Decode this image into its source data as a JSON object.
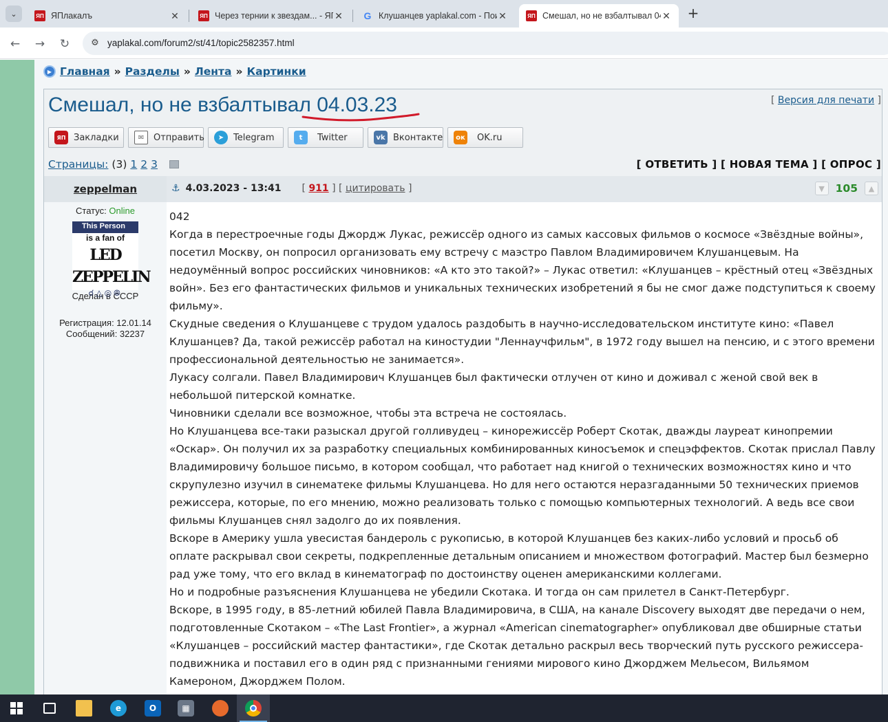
{
  "browser": {
    "tabs": [
      {
        "title": "ЯПлакалъ",
        "favicon": "yap-icon",
        "active": false
      },
      {
        "title": "Через тернии к звездам... - ЯП",
        "favicon": "yap-icon",
        "active": false
      },
      {
        "title": "Клушанцев yaplakal.com - Пои",
        "favicon": "google-icon",
        "active": false
      },
      {
        "title": "Смешал, но не взбалтывал 04.",
        "favicon": "yap-icon",
        "active": true
      }
    ],
    "url": "yaplakal.com/forum2/st/41/topic2582357.html"
  },
  "breadcrumbs": [
    {
      "label": "Главная"
    },
    {
      "label": "Разделы"
    },
    {
      "label": "Лента"
    },
    {
      "label": "Картинки"
    }
  ],
  "breadcrumb_sep": "»",
  "topic": {
    "title": "Смешал, но не взбалтывал 04.03.23",
    "print_label": "Версия для печати"
  },
  "share_buttons": [
    {
      "label": "Закладки",
      "icon": "yap-icon"
    },
    {
      "label": "Отправить",
      "icon": "mail-icon"
    },
    {
      "label": "Telegram",
      "icon": "telegram-icon"
    },
    {
      "label": "Twitter",
      "icon": "twitter-icon"
    },
    {
      "label": "Вконтакте",
      "icon": "vk-icon"
    },
    {
      "label": "OK.ru",
      "icon": "ok-icon"
    }
  ],
  "pager": {
    "label": "Страницы:",
    "count": "(3)",
    "pages": [
      "1",
      "2",
      "3"
    ]
  },
  "actions": {
    "reply": "[ ОТВЕТИТЬ ]",
    "new_topic": "[ НОВАЯ ТЕМА ]",
    "poll": "[ ОПРОС ]"
  },
  "post": {
    "author": "zeppelman",
    "status_label": "Статус:",
    "status_value": "Online",
    "avatar": {
      "top": "This Person",
      "mid": "is a fan of",
      "logo": "LED ZEPPELIN",
      "caption": "Сделан в СССР"
    },
    "registration": "Регистрация: 12.01.14",
    "messages": "Сообщений: 32237",
    "date": "4.03.2023 - 13:41",
    "number": "911",
    "quote_label": "цитировать",
    "rating": "105",
    "paragraphs": [
      "042",
      "Когда в перестроечные годы Джордж Лукас, режиссёр одного из самых кассовых фильмов о космосе «Звёздные войны», посетил Москву, он попросил организовать ему встречу с маэстро Павлом Владимировичем Клушанцевым. На недоумённый вопрос российских чиновников: «А кто это такой?» – Лукас ответил: «Клушанцев – крёстный отец «Звёздных войн». Без его фантастических фильмов и уникальных технических изобретений я бы не смог даже подступиться к своему фильму».",
      "Скудные сведения о Клушанцеве с трудом удалось раздобыть в научно-исследовательском институте кино: «Павел Клушанцев? Да, такой режиссёр работал на киностудии \"Леннаучфильм\", в 1972 году вышел на пенсию, и с этого времени профессиональной деятельностью не занимается».",
      "Лукасу солгали. Павел Владимирович Клушанцев был фактически отлучен от кино и доживал с женой свой век в небольшой питерской комнатке.",
      "Чиновники сделали все возможное, чтобы эта встреча не состоялась.",
      "Но Клушанцева все-таки разыскал другой голливудец – кинорежиссёр Роберт Скотак, дважды лауреат кинопремии «Оскар». Он получил их за разработку специальных комбинированных киносъемок и спецэффектов. Скотак прислал Павлу Владимировичу большое письмо, в котором сообщал, что работает над книгой о технических возможностях кино и что скрупулезно изучил в синематеке фильмы Клушанцева. Но для него остаются неразгаданными 50 технических приемов режиссера, которые, по его мнению, можно реализовать только с помощью компьютерных технологий. А ведь все свои фильмы Клушанцев снял задолго до их появления.",
      "Вскоре в Америку ушла увесистая бандероль с рукописью, в которой Клушанцев без каких-либо условий и просьб об оплате раскрывал свои секреты, подкрепленные детальным описанием и множеством фотографий. Мастер был безмерно рад уже тому, что его вклад в кинематограф по достоинству оценен американскими коллегами.",
      "Но и подробные разъяснения Клушанцева не убедили Скотака. И тогда он сам прилетел в Санкт-Петербург.",
      "Вскоре, в 1995 году, в 85-летний юбилей Павла Владимировича, в США, на канале Discovery выходят две передачи о нем, подготовленные Скотаком – «The Last Frontier», а журнал «American cinematographer» опубликовал две обширные статьи «Клушанцев – российский мастер фантастики», где Скотак детально раскрыл весь творческий путь русского режиссера-подвижника и поставил его в один ряд с признанными гениями мирового кино Джорджем Мельесом, Вильямом Камероном, Джорджем Полом."
    ]
  },
  "colors": {
    "link": "#1a5c8d",
    "annotation_red": "#d11a2a",
    "online_green": "#2a9a2a",
    "rating_green": "#2a8a2a",
    "side_strip": "#8fc9a8"
  },
  "taskbar": [
    {
      "icon": "windows-start-icon"
    },
    {
      "icon": "task-view-icon"
    },
    {
      "icon": "file-explorer-icon"
    },
    {
      "icon": "edge-icon"
    },
    {
      "icon": "outlook-icon"
    },
    {
      "icon": "calculator-icon"
    },
    {
      "icon": "firefox-icon"
    },
    {
      "icon": "chrome-icon",
      "active": true
    }
  ]
}
